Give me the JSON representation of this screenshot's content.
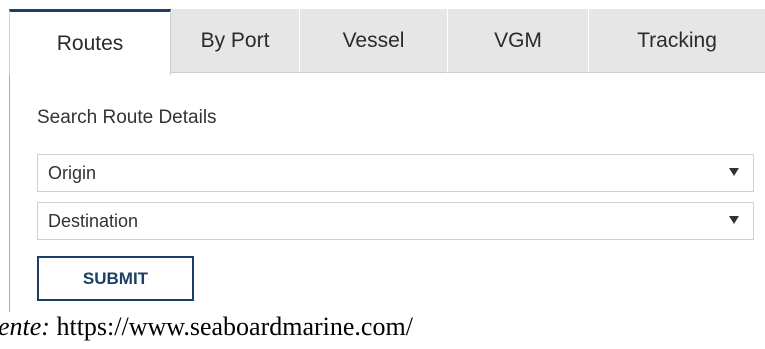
{
  "tabs": [
    {
      "label": "Routes",
      "active": true
    },
    {
      "label": "By Port",
      "active": false
    },
    {
      "label": "Vessel",
      "active": false
    },
    {
      "label": "VGM",
      "active": false
    },
    {
      "label": "Tracking",
      "active": false
    }
  ],
  "panel": {
    "heading": "Search Route Details",
    "origin_placeholder": "Origin",
    "destination_placeholder": "Destination",
    "submit_label": "SUBMIT",
    "dropdown_icon": "caret-down-icon"
  },
  "caption": {
    "prefix": "ente:",
    "url": " https://www.seaboardmarine.com/"
  },
  "colors": {
    "accent": "#1b3f66",
    "tab_bg": "#e6e6e6",
    "border": "#cfcfcf"
  }
}
